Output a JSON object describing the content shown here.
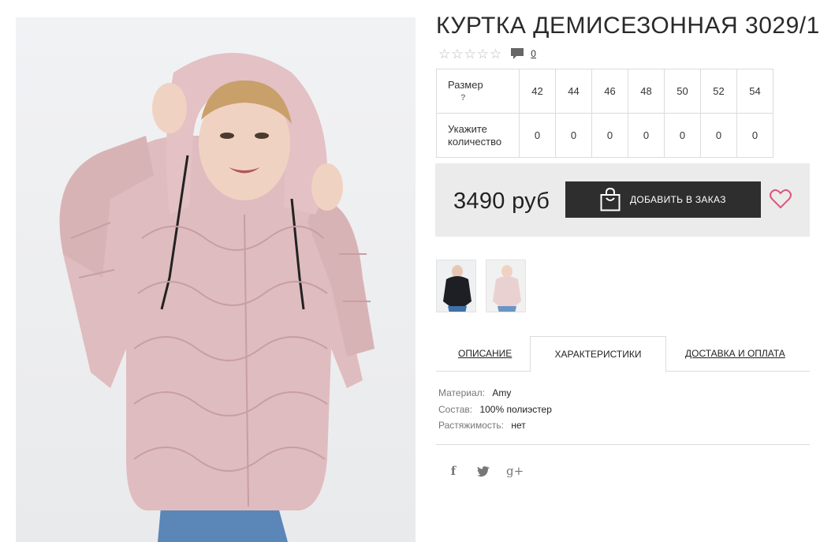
{
  "product": {
    "title": "КУРТКА ДЕМИСЕЗОННАЯ 3029/1",
    "rating_stars": 5,
    "rating_value": 0,
    "comments_count": "0",
    "price": "3490 руб"
  },
  "sizes_table": {
    "size_label": "Размер",
    "size_hint": "?",
    "qty_label": "Укажите количество",
    "sizes": [
      "42",
      "44",
      "46",
      "48",
      "50",
      "52",
      "54"
    ],
    "quantities": [
      "0",
      "0",
      "0",
      "0",
      "0",
      "0",
      "0"
    ]
  },
  "buy": {
    "add_button_label": "ДОБАВИТЬ В ЗАКАЗ"
  },
  "thumbnails": [
    {
      "icon": "jacket-black-thumbnail"
    },
    {
      "icon": "jacket-pink-thumbnail"
    }
  ],
  "tabs": [
    {
      "label": "ОПИСАНИЕ"
    },
    {
      "label": "ХАРАКТЕРИСТИКИ"
    },
    {
      "label": "ДОСТАВКА И ОПЛАТА"
    }
  ],
  "characteristics": [
    {
      "key": "Материал:",
      "value": "Amy"
    },
    {
      "key": "Состав:",
      "value": "100% полиэстер"
    },
    {
      "key": "Растяжимость:",
      "value": "нет"
    }
  ],
  "social": [
    {
      "icon": "facebook-icon",
      "glyph": "f"
    },
    {
      "icon": "twitter-icon",
      "glyph": "t"
    },
    {
      "icon": "google-plus-icon",
      "glyph": "g+"
    }
  ],
  "colors": {
    "button_bg": "#2e2e2e",
    "heart": "#d9577a",
    "buybox_bg": "#ebebeb",
    "jacket": "#ddb8bb"
  }
}
